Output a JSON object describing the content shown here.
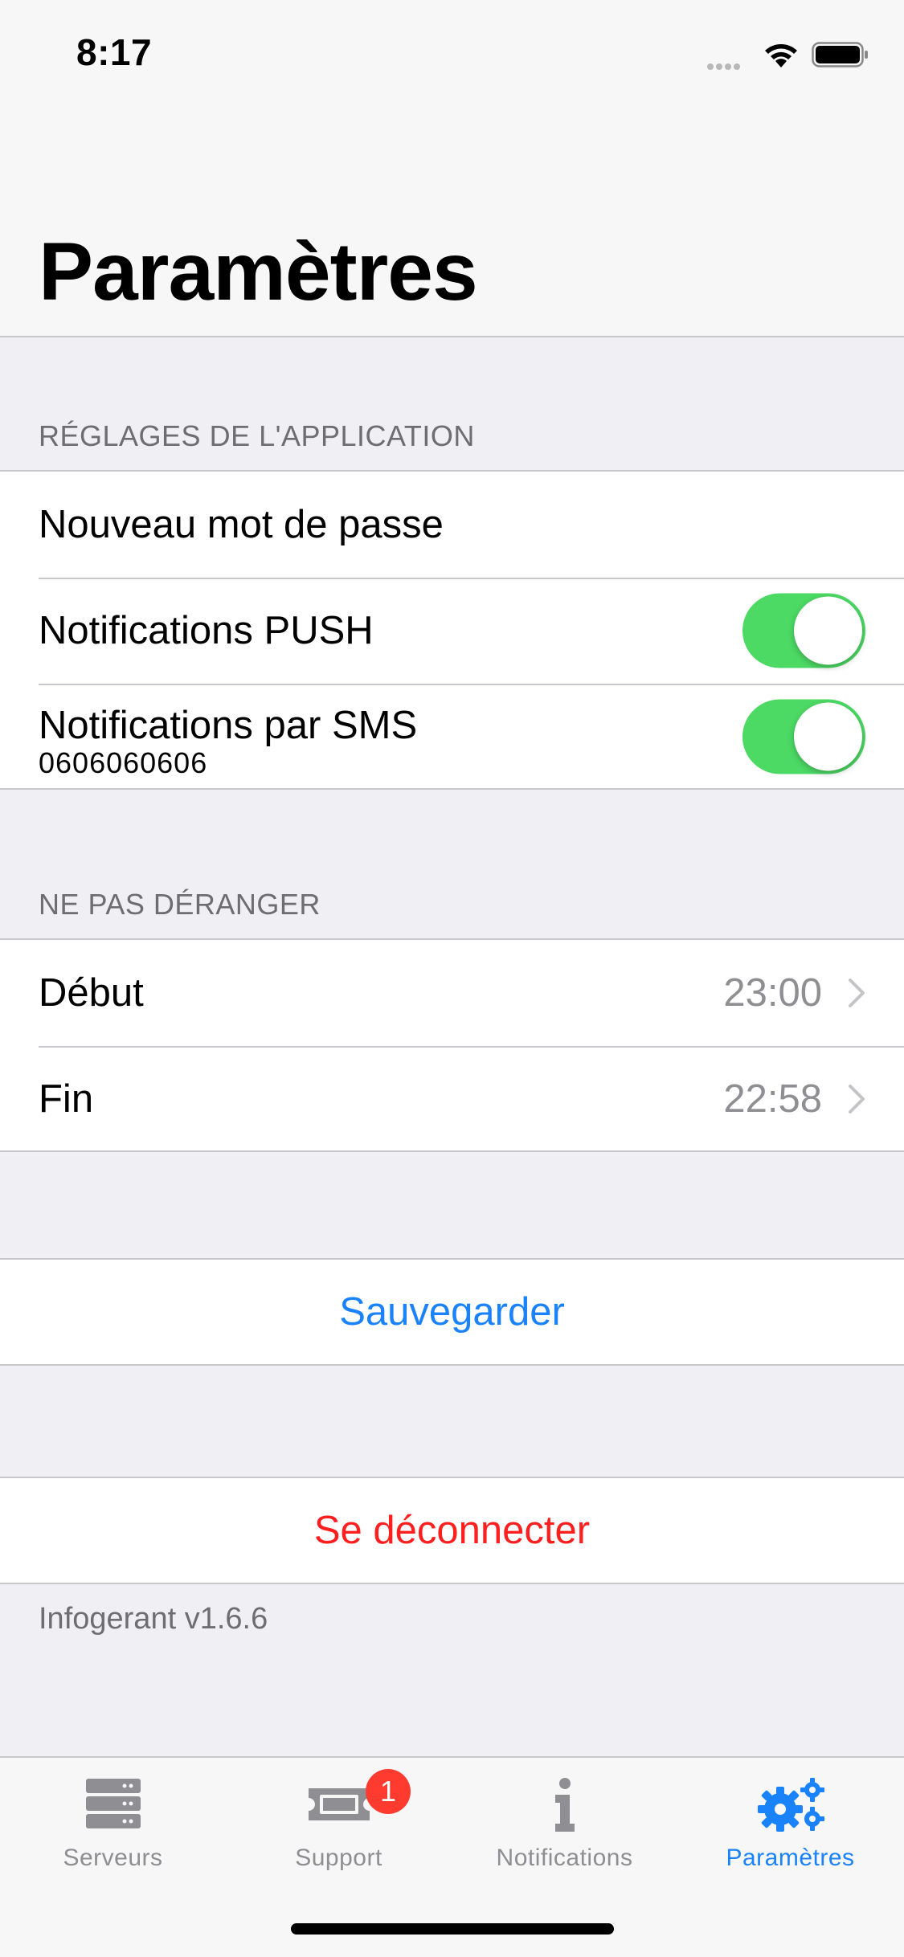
{
  "status_bar": {
    "time": "8:17",
    "icons": [
      "signal-dots-icon",
      "wifi-icon",
      "battery-icon"
    ]
  },
  "page": {
    "title": "Paramètres"
  },
  "app_settings": {
    "header": "RÉGLAGES DE L'APPLICATION",
    "new_password_label": "Nouveau mot de passe",
    "push_label": "Notifications PUSH",
    "push_enabled": true,
    "sms_label": "Notifications par SMS",
    "sms_phone": "0606060606",
    "sms_enabled": true
  },
  "dnd": {
    "header": "NE PAS DÉRANGER",
    "start_label": "Début",
    "start_value": "23:00",
    "end_label": "Fin",
    "end_value": "22:58"
  },
  "actions": {
    "save_label": "Sauvegarder",
    "logout_label": "Se déconnecter"
  },
  "footer": {
    "version": "Infogerant v1.6.6"
  },
  "tabbar": {
    "tabs": [
      {
        "label": "Serveurs",
        "icon": "servers-icon"
      },
      {
        "label": "Support",
        "icon": "ticket-icon",
        "badge": "1"
      },
      {
        "label": "Notifications",
        "icon": "info-icon"
      },
      {
        "label": "Paramètres",
        "icon": "gears-icon",
        "active": true
      }
    ]
  },
  "colors": {
    "accent": "#1a82fb",
    "toggle_on": "#4cd964",
    "destructive": "#ff1f1f",
    "badge": "#ff3b30"
  }
}
